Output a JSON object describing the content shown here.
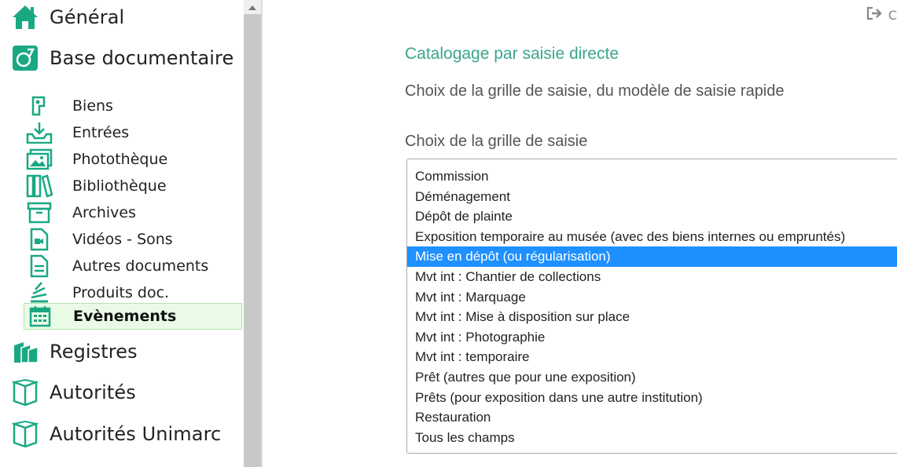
{
  "sidebar": {
    "top_items": [
      {
        "label": "Général",
        "icon": "home-icon"
      },
      {
        "label": "Base documentaire",
        "icon": "document-base-icon"
      },
      {
        "label": "Registres",
        "icon": "books-stack-icon"
      },
      {
        "label": "Autorités",
        "icon": "open-book-icon"
      },
      {
        "label": "Autorités Unimarc",
        "icon": "open-book-icon"
      }
    ],
    "sub_items": [
      {
        "label": "Biens",
        "icon": "object-icon"
      },
      {
        "label": "Entrées",
        "icon": "inbox-download-icon"
      },
      {
        "label": "Photothèque",
        "icon": "photos-icon"
      },
      {
        "label": "Bibliothèque",
        "icon": "library-icon"
      },
      {
        "label": "Archives",
        "icon": "archive-box-icon"
      },
      {
        "label": "Vidéos - Sons",
        "icon": "video-file-icon"
      },
      {
        "label": "Autres documents",
        "icon": "document-icon"
      },
      {
        "label": "Produits doc.",
        "icon": "stacked-docs-icon"
      },
      {
        "label": "Evènements",
        "icon": "calendar-icon",
        "active": true
      }
    ]
  },
  "header": {
    "logout_label": "C"
  },
  "main": {
    "title": "Catalogage par saisie directe",
    "subtitle": "Choix de la grille de saisie, du modèle de saisie rapide",
    "grid_label": "Choix de la grille de saisie",
    "options": [
      "Commission",
      "Déménagement",
      "Dépôt de plainte",
      "Exposition temporaire au musée (avec des biens internes ou empruntés)",
      "Mise en dépôt (ou régularisation)",
      "Mvt int : Chantier de collections",
      "Mvt int : Marquage",
      "Mvt int : Mise à disposition sur place",
      "Mvt int : Photographie",
      "Mvt int : temporaire",
      "Prêt (autres que pour une exposition)",
      "Prêts (pour exposition dans une autre institution)",
      "Restauration",
      "Tous les champs"
    ],
    "selected_index": 4
  },
  "colors": {
    "accent": "#3aa58c",
    "icon": "#1aa884",
    "selection": "#1e90ff",
    "active_bg": "#e9fbe7"
  }
}
